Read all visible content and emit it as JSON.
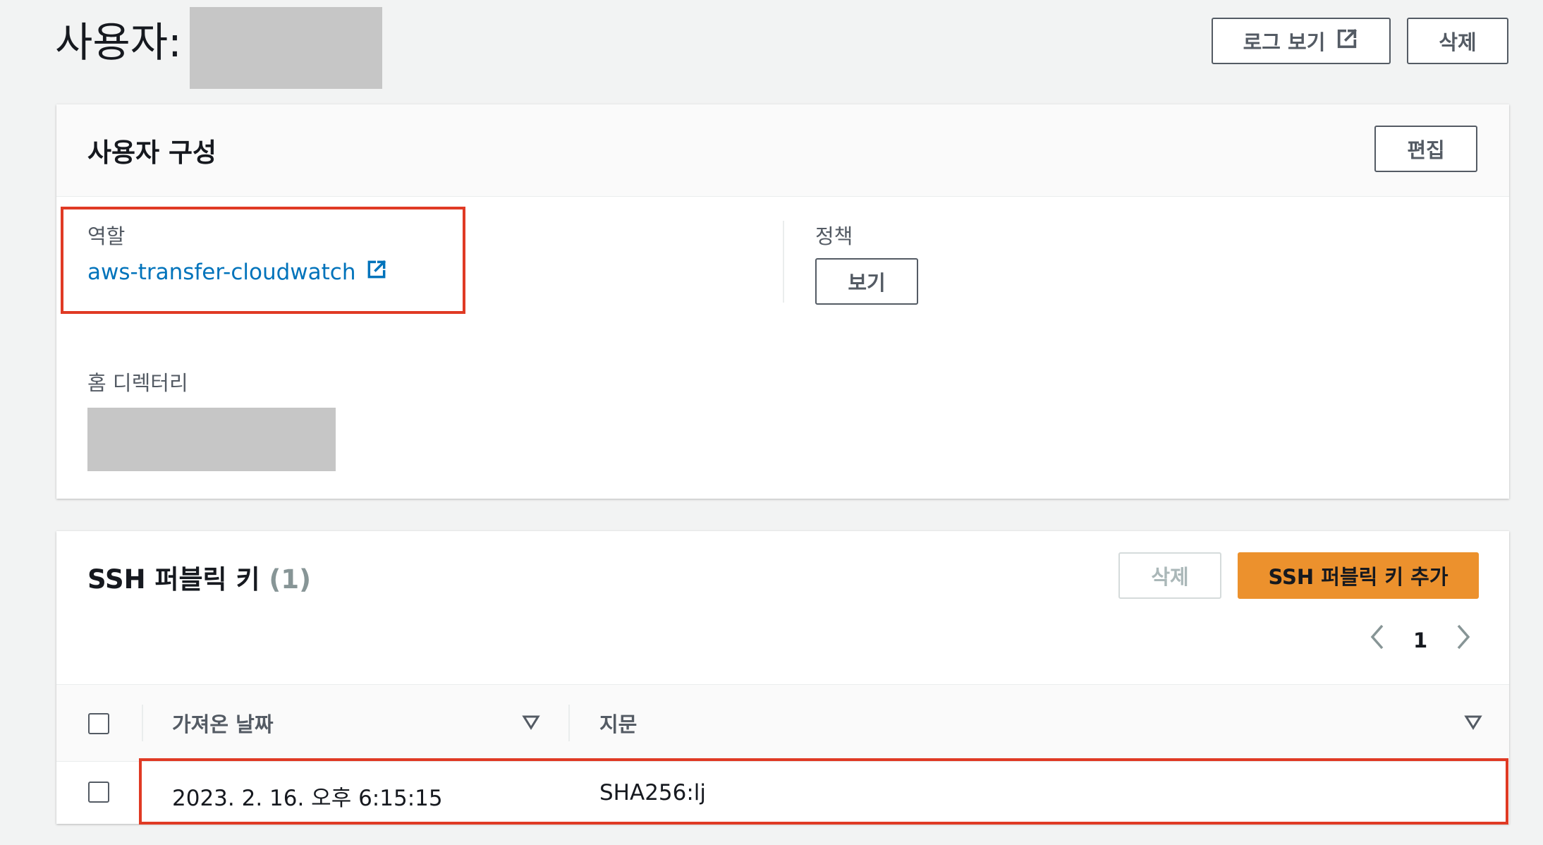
{
  "header": {
    "title": "사용자:",
    "logs_button": "로그 보기",
    "delete_button": "삭제"
  },
  "user_config": {
    "title": "사용자 구성",
    "edit_button": "편집",
    "role_label": "역할",
    "role_value": "aws-transfer-cloudwatch",
    "policy_label": "정책",
    "policy_button": "보기",
    "home_dir_label": "홈 디렉터리"
  },
  "ssh_keys": {
    "title": "SSH 퍼블릭 키",
    "count": "(1)",
    "delete_button": "삭제",
    "add_button": "SSH 퍼블릭 키 추가",
    "pagination": {
      "current_page": "1"
    },
    "columns": [
      "가져온 날짜",
      "지문"
    ],
    "rows": [
      {
        "imported_date": "2023. 2. 16. 오후 6:15:15",
        "fingerprint": "SHA256:lj"
      }
    ]
  },
  "colors": {
    "primary_button": "#ec912d",
    "link": "#0073bb",
    "highlight": "#e03a24"
  },
  "icons": [
    "external-link-icon",
    "chevron-left-icon",
    "chevron-right-icon",
    "sort-caret-icon"
  ]
}
